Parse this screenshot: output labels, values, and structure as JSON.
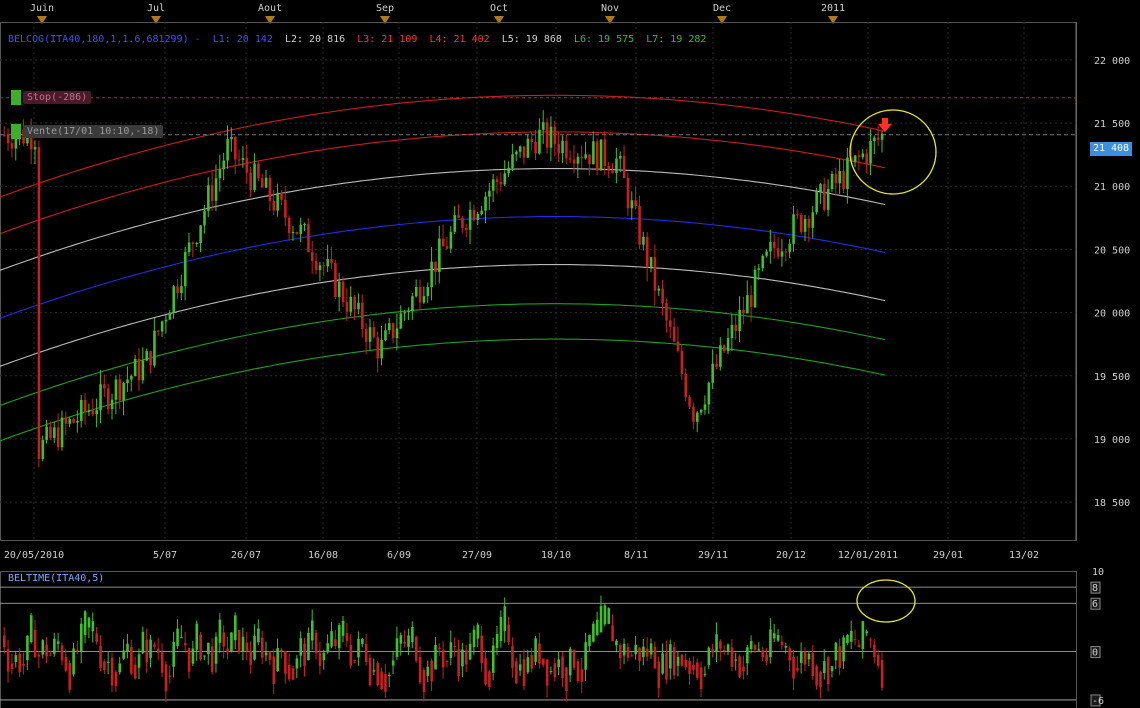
{
  "months": [
    "Juin",
    "Jul",
    "Aout",
    "Sep",
    "Oct",
    "Nov",
    "Dec",
    "2011"
  ],
  "indicator": {
    "name": "BELCOG(ITA40,180,1,1.6,681299)",
    "l1": "L1: 20 142",
    "l2": "L2: 20 816",
    "l3": "L3: 21 109",
    "l4": "L4: 21 402",
    "l5": "L5: 19 868",
    "l6": "L6: 19 575",
    "l7": "L7: 19 282"
  },
  "tags": {
    "stop": "Stop(-286)",
    "sell": "Vente(17/01 10:10,-18)"
  },
  "last_price": "21 408",
  "oscillator": {
    "title": "BELTIME(ITA40,5)"
  },
  "colors": {
    "up": "#3fc02a",
    "down": "#c8201e",
    "regression": "#2233ff",
    "upper_band": "#e02020",
    "lower_band": "#22b022",
    "mid_band": "#cfcfcf",
    "highlight": "#e8e820"
  },
  "chart_data": [
    {
      "type": "line",
      "x_ticks": [
        "20/05/2010",
        "5/07",
        "26/07",
        "16/08",
        "6/09",
        "27/09",
        "18/10",
        "8/11",
        "29/11",
        "20/12",
        "12/01/2011",
        "29/01",
        "13/02"
      ],
      "y_ticks": [
        "18 500",
        "19 000",
        "19 500",
        "20 000",
        "20 500",
        "21 000",
        "21 500",
        "22 000"
      ],
      "ylim": [
        18200,
        22300
      ],
      "grid": true,
      "bands": [
        {
          "name": "L1",
          "value": 20142
        },
        {
          "name": "L2",
          "value": 20816
        },
        {
          "name": "L3",
          "value": 21109
        },
        {
          "name": "L4",
          "value": 21402
        },
        {
          "name": "L5",
          "value": 19868
        },
        {
          "name": "L6",
          "value": 19575
        },
        {
          "name": "L7",
          "value": 19282
        }
      ],
      "price_path": [
        {
          "x": "20/05/2010",
          "close": 18900
        },
        {
          "x": "5/07",
          "close": 19600
        },
        {
          "x": "26/07",
          "close": 21300
        },
        {
          "x": "16/08",
          "close": 20600
        },
        {
          "x": "6/09",
          "close": 19700
        },
        {
          "x": "27/09",
          "close": 20700
        },
        {
          "x": "18/10",
          "close": 21400
        },
        {
          "x": "8/11",
          "close": 21200
        },
        {
          "x": "29/11",
          "close": 19200
        },
        {
          "x": "20/12",
          "close": 20500
        },
        {
          "x": "12/01/2011",
          "close": 21408
        }
      ],
      "last_value": 21408
    },
    {
      "type": "bar",
      "y_ticks": [
        "10",
        "8",
        "6",
        "0",
        "-6"
      ],
      "ylim": [
        -7,
        10
      ]
    }
  ]
}
